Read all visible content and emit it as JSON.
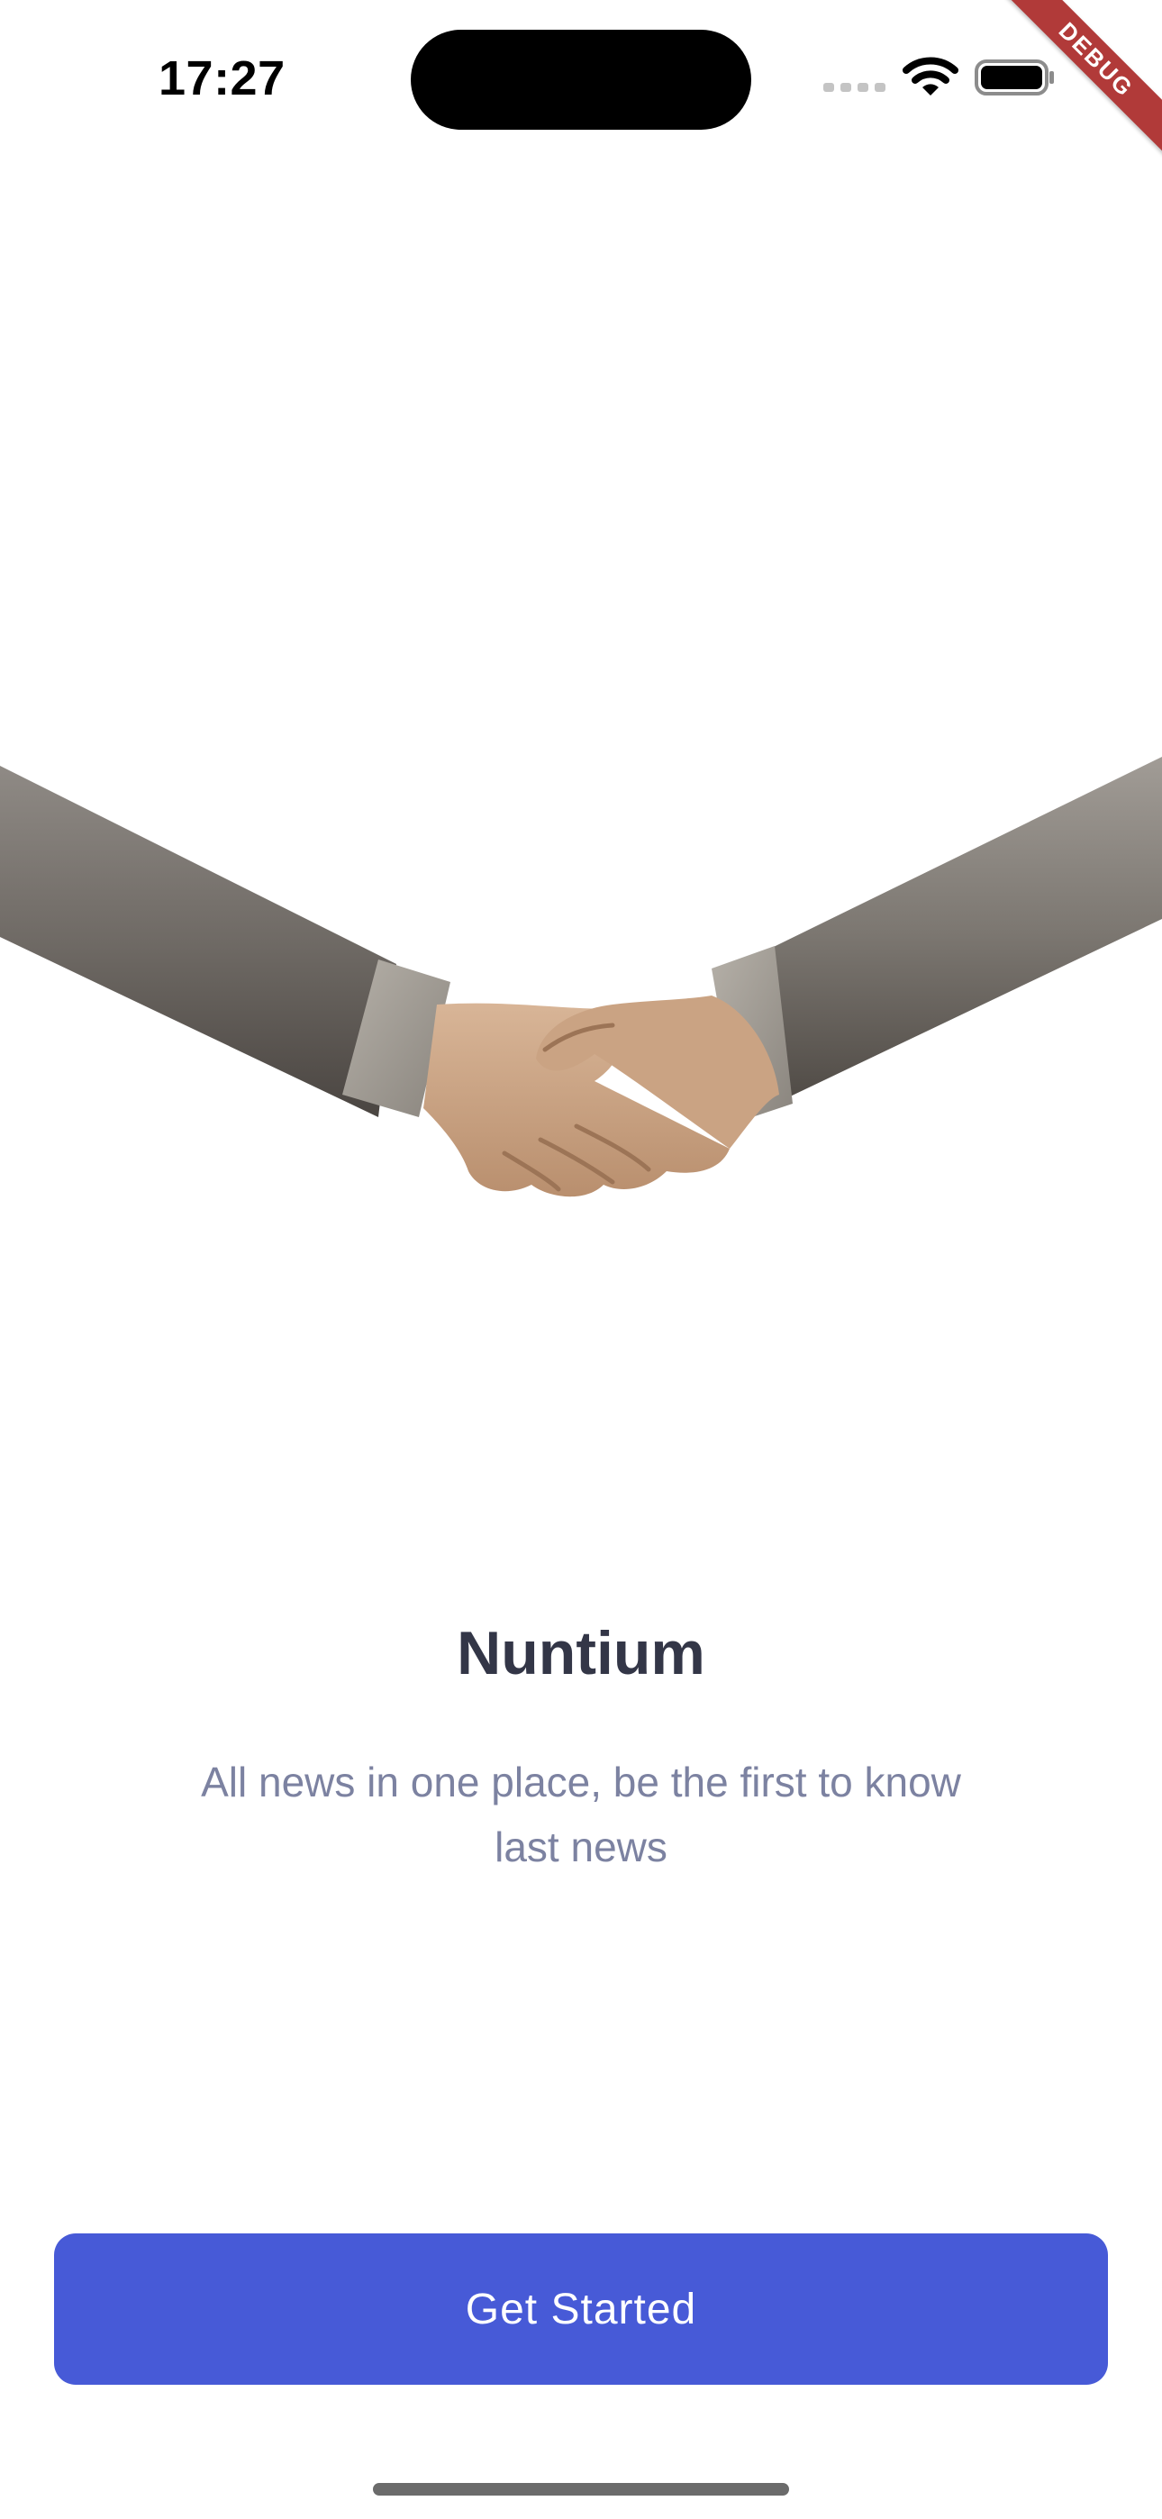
{
  "status_bar": {
    "time": "17:27",
    "icons": [
      "signal-icon",
      "wifi-icon",
      "battery-icon"
    ]
  },
  "debug_banner": {
    "label": "DEBUG"
  },
  "onboarding": {
    "title": "Nuntium",
    "subtitle": "All news in one place, be the first to know last news",
    "illustration": "handshake-illustration"
  },
  "actions": {
    "get_started_label": "Get Started"
  },
  "colors": {
    "accent": "#475ad7",
    "title": "#333647",
    "subtitle": "#7c82a1",
    "background": "#ffffff",
    "debug_ribbon": "#b13a39"
  }
}
